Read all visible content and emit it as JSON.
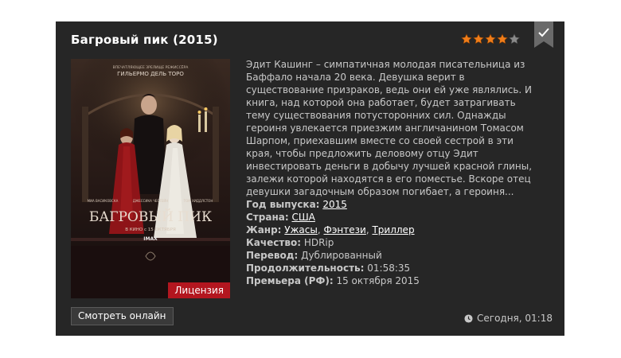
{
  "movie": {
    "title": "Багровый пик (2015)",
    "rating_stars": 4,
    "rating_max": 5,
    "description": "Эдит Кашинг – симпатичная молодая писательница из Баффало начала 20 века. Девушка верит в существование призраков, ведь они ей уже являлись. И книга, над которой она работает, будет затрагивать тему существования потусторонних сил. Однажды героиня увлекается приезжим англичанином Томасом Шарпом, приехавшим вместе со своей сестрой в эти края, чтобы предложить деловому отцу Эдит инвестировать деньги в добычу лучшей красной глины, залежи которой находятся в его поместье. Вскоре отец девушки загадочным образом погибает, а героиня..."
  },
  "poster": {
    "badge": "Лицензия",
    "top_tagline": "ВПЕЧАТЛЯЮЩЕЕ ЗРЕЛИЩЕ РЕЖИССЁРА",
    "director": "ГИЛЬЕРМО ДЕЛЬ ТОРО",
    "actor_1": "МИА ВАСИКОВСКА",
    "actor_2": "ДЖЕССИКА ЧЕСТЕЙН",
    "actor_3": "ТОМ ХИДДЛСТОН",
    "film_title": "БАГРОВЫЙ ПИК",
    "release": "В КИНО с 15 ОКТЯБРЯ",
    "format": "IMAX"
  },
  "meta": {
    "year_label": "Год выпуска:",
    "year": "2015",
    "country_label": "Страна:",
    "country": "США",
    "genre_label": "Жанр:",
    "genre_1": "Ужасы",
    "genre_2": "Фэнтези",
    "genre_3": "Триллер",
    "genre_sep": ", ",
    "quality_label": "Качество:",
    "quality": "HDRip",
    "translation_label": "Перевод:",
    "translation": "Дублированный",
    "duration_label": "Продолжительность:",
    "duration": "01:58:35",
    "premiere_label": "Премьера (РФ):",
    "premiere": "15 октября 2015"
  },
  "footer": {
    "watch_button": "Смотреть онлайн",
    "date": "Сегодня, 01:18"
  },
  "colors": {
    "card_bg": "#262626",
    "star_on": "#f07d1a",
    "star_off": "#8a8a8a",
    "license_bg": "#b3161f"
  }
}
